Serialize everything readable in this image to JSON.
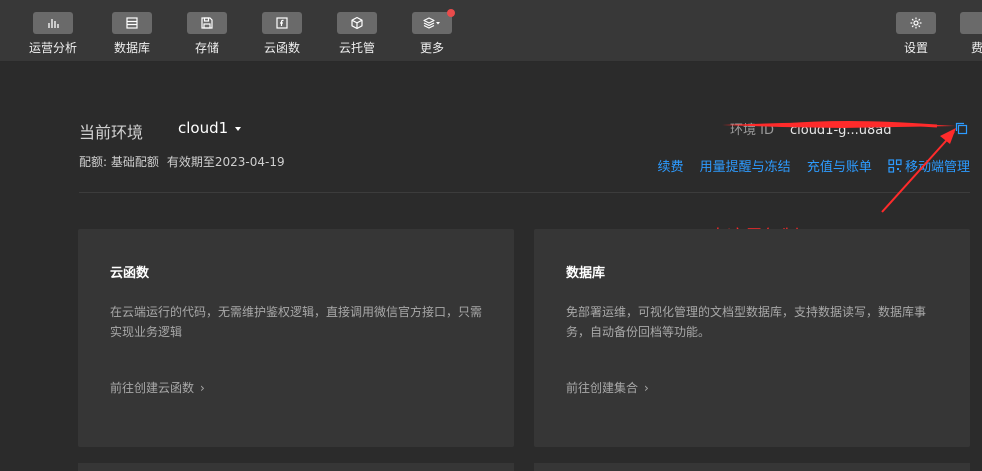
{
  "toolbar": {
    "items": [
      {
        "label": "运营分析",
        "icon": "bar-chart-icon"
      },
      {
        "label": "数据库",
        "icon": "database-icon"
      },
      {
        "label": "存储",
        "icon": "storage-icon"
      },
      {
        "label": "云函数",
        "icon": "function-icon"
      },
      {
        "label": "云托管",
        "icon": "cube-icon"
      },
      {
        "label": "更多",
        "icon": "layers-icon"
      },
      {
        "label": "设置",
        "icon": "gear-icon"
      },
      {
        "label": "费",
        "icon": "cost-icon"
      }
    ]
  },
  "env": {
    "label": "当前环境",
    "selected": "cloud1",
    "quota_prefix": "配额: 基础配额",
    "expiry": "有效期至2023-04-19",
    "id_label": "环境 ID",
    "id_value": "cloud1-g...u8ad"
  },
  "links": {
    "renew": "续费",
    "usage_alert": "用量提醒与冻结",
    "recharge": "充值与账单",
    "mobile_manage": "移动端管理"
  },
  "annotation": {
    "text": "点这里复制envId",
    "color": "#ff2b2b"
  },
  "cards": [
    {
      "title": "云函数",
      "desc": "在云端运行的代码，无需维护鉴权逻辑，直接调用微信官方接口，只需实现业务逻辑",
      "link": "前往创建云函数"
    },
    {
      "title": "数据库",
      "desc": "免部署运维，可视化管理的文档型数据库，支持数据读写，数据库事务，自动备份回档等功能。",
      "link": "前往创建集合"
    }
  ],
  "colors": {
    "accent_link": "#2d9bff",
    "toolbar_bg": "#383838",
    "page_bg": "#2b2b2b",
    "card_bg": "#363636"
  }
}
